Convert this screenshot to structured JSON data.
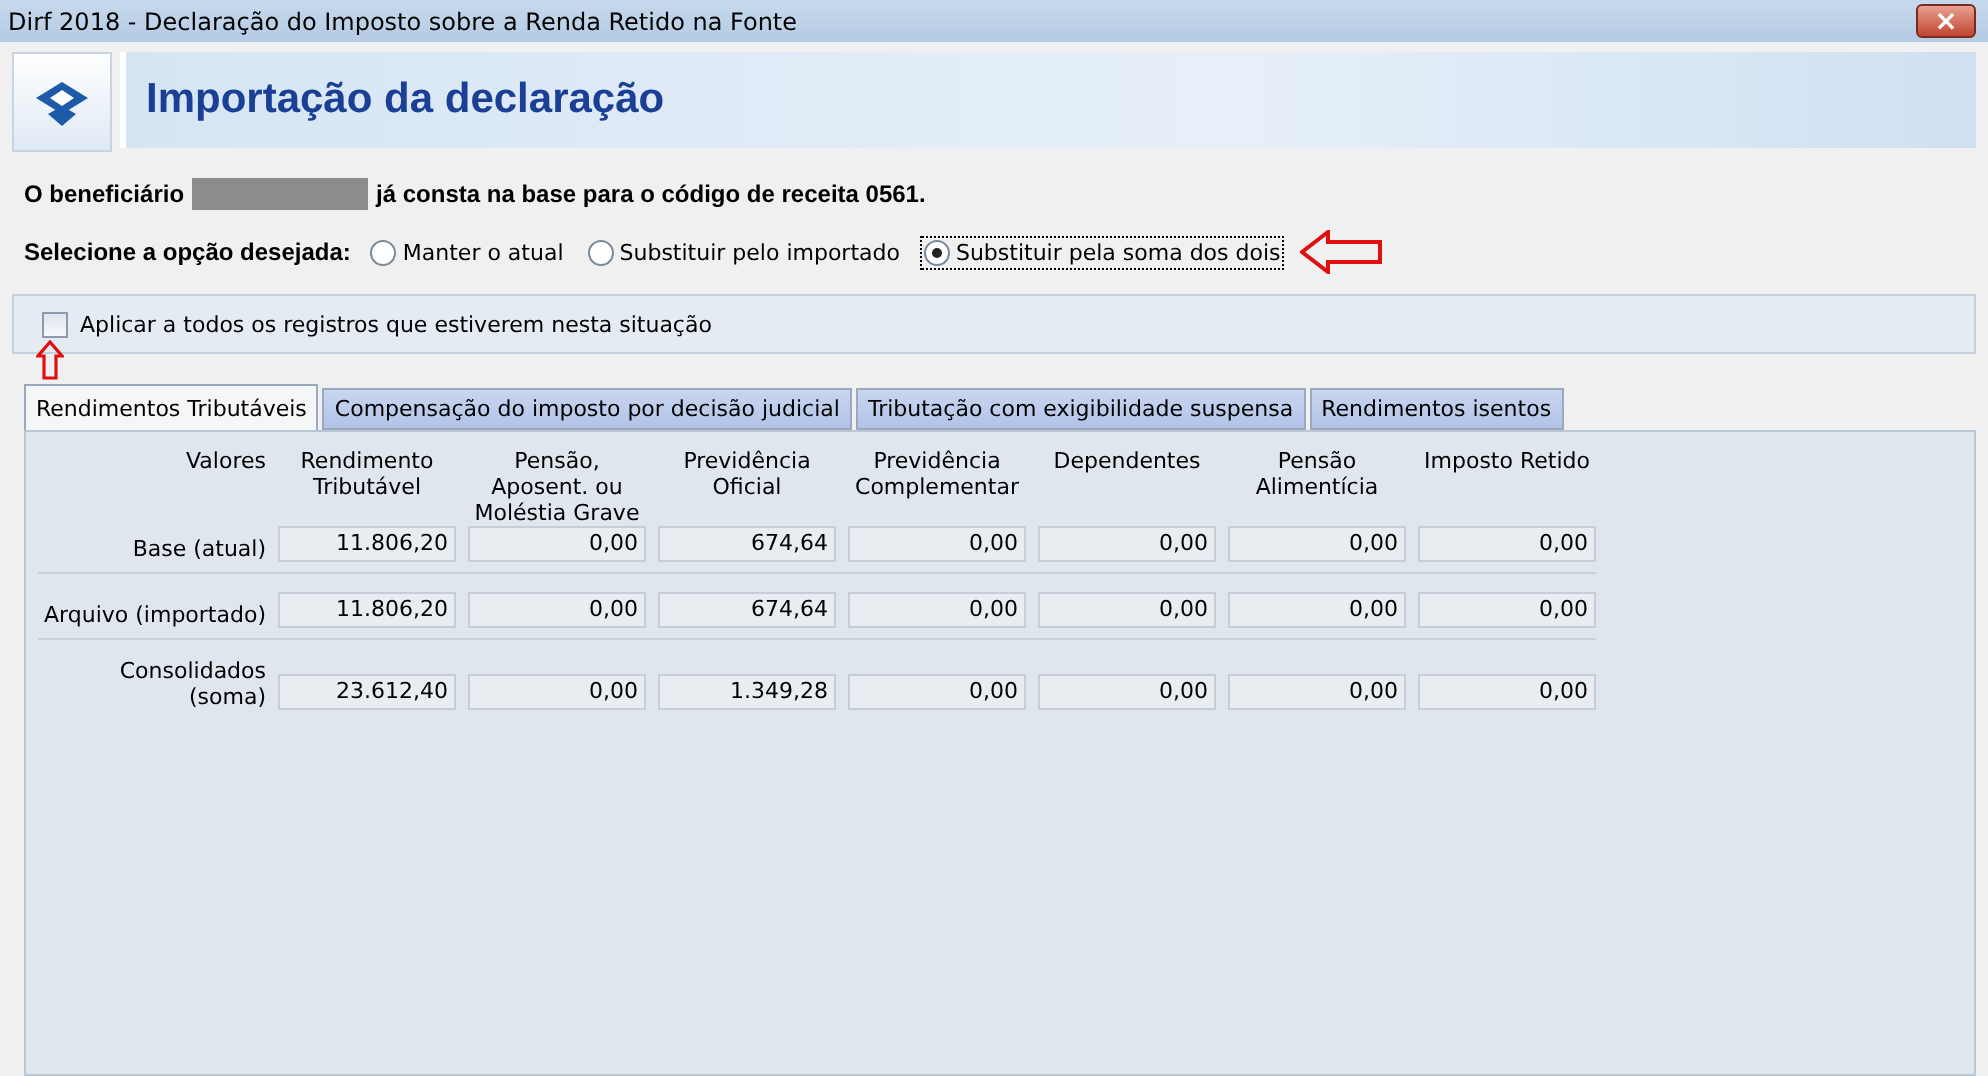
{
  "window": {
    "title": "Dirf 2018 - Declaração do Imposto sobre a Renda Retido na Fonte",
    "close": "×"
  },
  "header": {
    "title": "Importação da declaração"
  },
  "message": {
    "before": "O beneficiário",
    "after": "já consta na base para o código de receita 0561."
  },
  "option_group": {
    "label": "Selecione a opção desejada:",
    "options": [
      {
        "label": "Manter o atual",
        "selected": false
      },
      {
        "label": "Substituir pelo importado",
        "selected": false
      },
      {
        "label": "Substituir pela soma dos dois",
        "selected": true
      }
    ]
  },
  "apply_all": {
    "label": "Aplicar a todos os registros que estiverem nesta situação",
    "checked": false
  },
  "tabs": [
    {
      "label": "Rendimentos Tributáveis",
      "selected": true
    },
    {
      "label": "Compensação do imposto por decisão judicial",
      "selected": false
    },
    {
      "label": "Tributação com exigibilidade suspensa",
      "selected": false
    },
    {
      "label": "Rendimentos isentos",
      "selected": false
    }
  ],
  "table": {
    "columns": [
      "Valores",
      "Rendimento Tributável",
      "Pensão, Aposent. ou Moléstia Grave",
      "Previdência Oficial",
      "Previdência Complementar",
      "Dependentes",
      "Pensão Alimentícia",
      "Imposto Retido"
    ],
    "rows": [
      {
        "label": "Base (atual)",
        "values": [
          "11.806,20",
          "0,00",
          "674,64",
          "0,00",
          "0,00",
          "0,00",
          "0,00"
        ]
      },
      {
        "label": "Arquivo (importado)",
        "values": [
          "11.806,20",
          "0,00",
          "674,64",
          "0,00",
          "0,00",
          "0,00",
          "0,00"
        ]
      },
      {
        "label": "Consolidados (soma)",
        "values": [
          "23.612,40",
          "0,00",
          "1.349,28",
          "0,00",
          "0,00",
          "0,00",
          "0,00"
        ]
      }
    ]
  }
}
